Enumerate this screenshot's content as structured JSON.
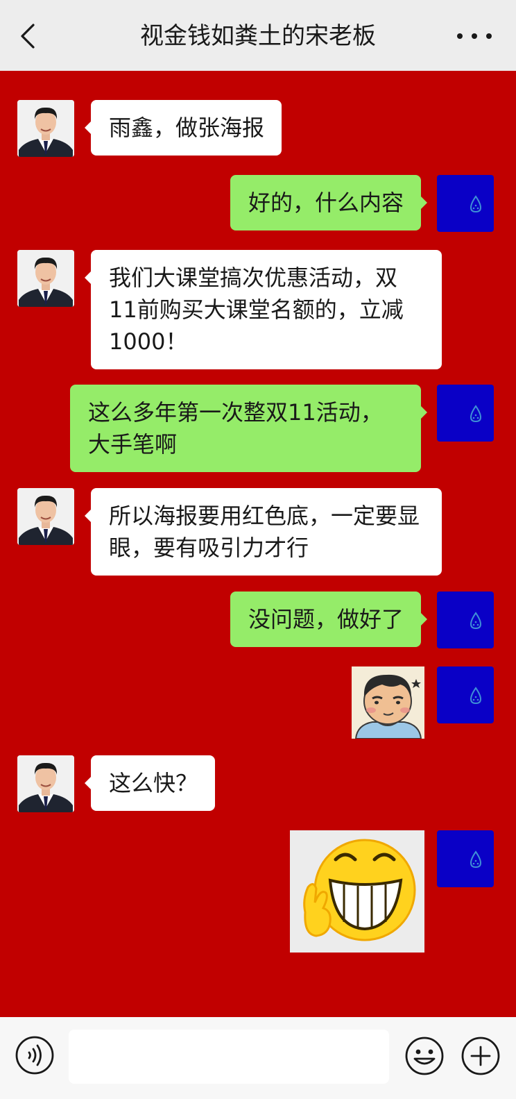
{
  "header": {
    "title": "视金钱如粪土的宋老板"
  },
  "messages": [
    {
      "sender": "boss",
      "type": "text",
      "text": "雨鑫，做张海报"
    },
    {
      "sender": "me",
      "type": "text",
      "text": "好的，什么内容"
    },
    {
      "sender": "boss",
      "type": "text",
      "text": "我们大课堂搞次优惠活动，双11前购买大课堂名额的，立减1000！"
    },
    {
      "sender": "me",
      "type": "text",
      "text": "这么多年第一次整双11活动，大手笔啊"
    },
    {
      "sender": "boss",
      "type": "text",
      "text": "所以海报要用红色底，一定要显眼，要有吸引力才行"
    },
    {
      "sender": "me",
      "type": "text",
      "text": "没问题，做好了"
    },
    {
      "sender": "me",
      "type": "sticker",
      "sticker": "cartoon-face-sticker"
    },
    {
      "sender": "boss",
      "type": "text",
      "text": "这么快？"
    },
    {
      "sender": "me",
      "type": "sticker",
      "sticker": "grinning-victory-emoji-sticker"
    }
  ],
  "colors": {
    "header_bg": "#ededed",
    "chat_bg": "#c10000",
    "incoming_bubble": "#ffffff",
    "outgoing_bubble": "#95ec69",
    "my_avatar_bg": "#0a00c6",
    "input_bar_bg": "#f7f7f7"
  },
  "icons": {
    "back": "chevron-left-icon",
    "more": "more-dots-icon",
    "voice": "voice-icon",
    "emoji": "emoji-icon",
    "plus": "plus-icon",
    "my_avatar": "water-drop-icon"
  }
}
